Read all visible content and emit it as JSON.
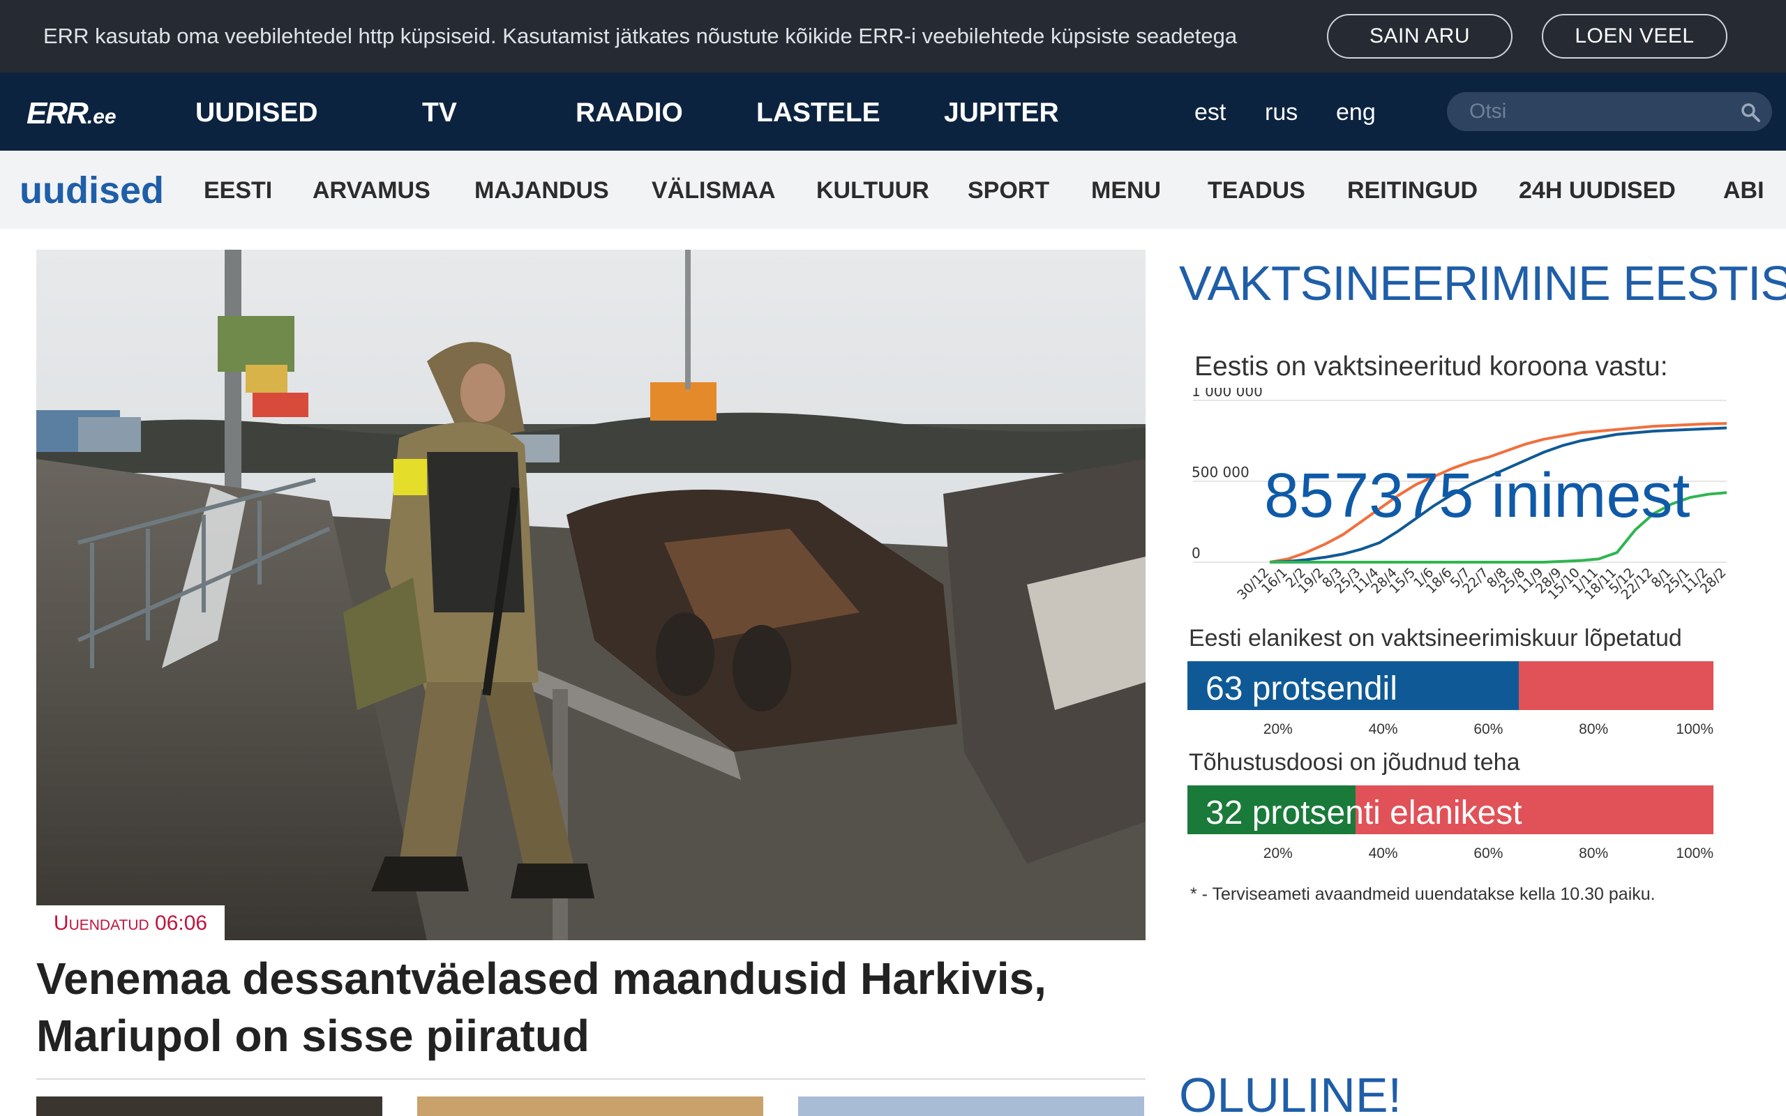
{
  "cookie": {
    "text": "ERR kasutab oma veebilehtedel http küpsiseid. Kasutamist jätkates nõustute kõikide ERR-i veebilehtede küpsiste seadetega",
    "agree_label": "SAIN ARU",
    "more_label": "LOEN VEEL"
  },
  "nav": {
    "logo": "ERR",
    "logo_suffix": ".ee",
    "items": [
      "UUDISED",
      "TV",
      "RAADIO",
      "LASTELE",
      "JUPITER"
    ],
    "langs": [
      "est",
      "rus",
      "eng"
    ],
    "search_placeholder": "Otsi"
  },
  "subnav": {
    "section": "uudised",
    "items": [
      "EESTI",
      "ARVAMUS",
      "MAJANDUS",
      "VÄLISMAA",
      "KULTUUR",
      "SPORT",
      "MENU",
      "TEADUS",
      "REITINGUD",
      "24H UUDISED",
      "ABI"
    ]
  },
  "hero": {
    "badge": "Uuendatud 06:06",
    "headline": "Venemaa dessantväelased maandusid Harkivis, Mariupol on sisse piiratud"
  },
  "vaccination": {
    "title": "VAKTSINEERIMINE EESTIS",
    "subtitle": "Eestis on vaktsineeritud koroona vastu:",
    "big_number": "857375 inimest",
    "completed_label": "Eesti elanikest on vaktsineerimiskuur lõpetatud",
    "completed_text": "63 protsendil",
    "completed_pct": 63,
    "booster_label": "Tõhustusdoosi on jõudnud teha",
    "booster_text": "32 protsenti elanikest",
    "booster_pct": 32,
    "pct_ticks": [
      "20%",
      "40%",
      "60%",
      "80%",
      "100%"
    ],
    "footnote": "* - Terviseameti avaandmeid uuendatakse kella 10.30 paiku."
  },
  "section2_title": "OLULINE!",
  "colors": {
    "cookie_bg": "#262b33",
    "nav_bg": "#0c2340",
    "accent_blue": "#1f5ea8",
    "bar_red": "#e05258",
    "bar_blue": "#0f5a96",
    "bar_green": "#1a7a3a",
    "badge_red": "#c0143c"
  },
  "chart_data": {
    "type": "line",
    "x": [
      "30/12",
      "16/1",
      "2/2",
      "19/2",
      "8/3",
      "25/3",
      "11/4",
      "28/4",
      "15/5",
      "1/6",
      "18/6",
      "5/7",
      "22/7",
      "8/8",
      "25/8",
      "11/9",
      "28/9",
      "15/10",
      "1/11",
      "18/11",
      "5/12",
      "22/12",
      "8/1",
      "25/1",
      "11/2",
      "28/2"
    ],
    "yticks": [
      "0",
      "500 000",
      "1 000 000"
    ],
    "ylim": [
      0,
      1000000
    ],
    "series": [
      {
        "color": "#f0703e",
        "values": [
          0,
          20000,
          60000,
          110000,
          170000,
          250000,
          330000,
          410000,
          480000,
          530000,
          580000,
          620000,
          650000,
          690000,
          730000,
          760000,
          780000,
          800000,
          810000,
          820000,
          830000,
          840000,
          845000,
          850000,
          855000,
          857375
        ]
      },
      {
        "color": "#0f5a96",
        "values": [
          0,
          5000,
          15000,
          30000,
          50000,
          80000,
          120000,
          190000,
          270000,
          350000,
          420000,
          480000,
          530000,
          580000,
          630000,
          680000,
          720000,
          750000,
          770000,
          790000,
          800000,
          810000,
          815000,
          820000,
          825000,
          830000
        ]
      },
      {
        "color": "#2fb550",
        "values": [
          0,
          0,
          0,
          0,
          0,
          0,
          0,
          0,
          0,
          0,
          0,
          0,
          0,
          0,
          0,
          0,
          5000,
          10000,
          20000,
          60000,
          200000,
          300000,
          360000,
          400000,
          420000,
          430000
        ]
      }
    ]
  }
}
